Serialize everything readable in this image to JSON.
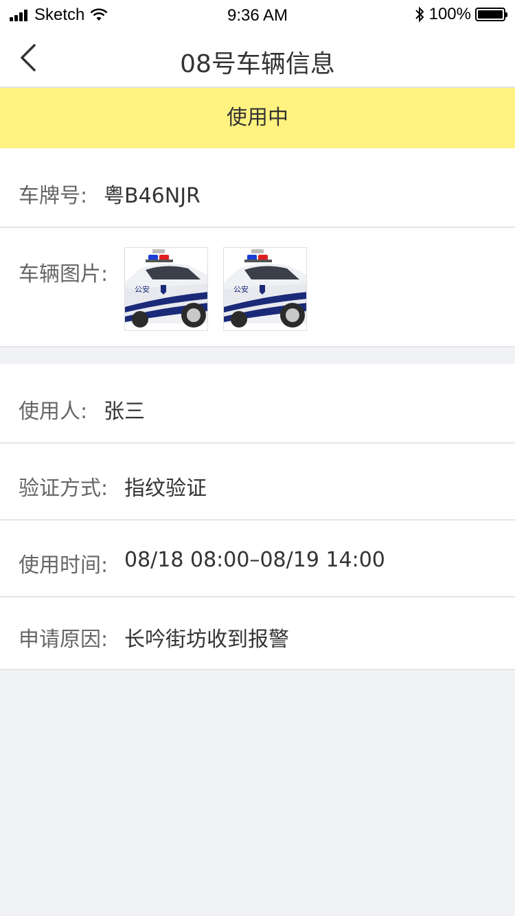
{
  "status_bar": {
    "carrier": "Sketch",
    "time": "9:36 AM",
    "battery": "100%"
  },
  "nav": {
    "title": "08号车辆信息"
  },
  "banner": {
    "status": "使用中"
  },
  "vehicle": {
    "plate_label": "车牌号:",
    "plate_value": "粤B46NJR",
    "photos_label": "车辆图片:",
    "photos": [
      {
        "name": "police-car-photo",
        "badge_text": "公安"
      },
      {
        "name": "police-car-photo",
        "badge_text": "公安"
      }
    ]
  },
  "usage": {
    "user_label": "使用人:",
    "user_value": "张三",
    "verify_label": "验证方式:",
    "verify_value": "指纹验证",
    "time_label": "使用时间:",
    "time_value": "08/18 08:00–08/19 14:00",
    "reason_label": "申请原因:",
    "reason_value": "长吟街坊收到报警"
  },
  "colors": {
    "banner_bg": "#fff280",
    "page_bg": "#f1f2f6"
  }
}
